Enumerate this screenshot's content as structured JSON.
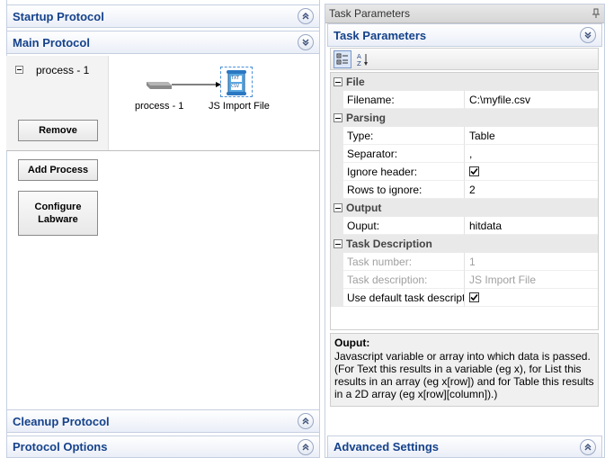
{
  "left_panel": {
    "startup_protocol": "Startup Protocol",
    "main_protocol": "Main Protocol",
    "cleanup_protocol": "Cleanup Protocol",
    "protocol_options": "Protocol Options",
    "tree_item": "process - 1",
    "remove_button": "Remove",
    "add_process_button": "Add Process",
    "configure_labware_button": "Configure Labware",
    "node_process_label": "process - 1",
    "node_js_label": "JS Import File",
    "js_icon_lines": [
      "TXT",
      "CSV"
    ]
  },
  "right_panel": {
    "window_title": "Task Parameters",
    "section_title": "Task Parameters",
    "advanced_settings": "Advanced Settings",
    "categories": {
      "file": "File",
      "parsing": "Parsing",
      "output": "Output",
      "task_description": "Task Description"
    },
    "props": {
      "filename": {
        "name": "Filename:",
        "value": "C:\\myfile.csv"
      },
      "type": {
        "name": "Type:",
        "value": "Table"
      },
      "separator": {
        "name": "Separator:",
        "value": ","
      },
      "ignore_header": {
        "name": "Ignore header:",
        "checked": true
      },
      "rows_to_ignore": {
        "name": "Rows to ignore:",
        "value": "2"
      },
      "ouput": {
        "name": "Ouput:",
        "value": "hitdata"
      },
      "task_number": {
        "name": "Task number:",
        "value": "1"
      },
      "task_description": {
        "name": "Task description:",
        "value": "JS Import File"
      },
      "use_default": {
        "name": "Use default task descript",
        "checked": true
      }
    },
    "description": {
      "title": "Ouput:",
      "text": "Javascript variable or array into which data is passed. (For Text this results in a variable (eg x), for List this results in an array (eg x[row]) and for Table this results in a 2D array (eg x[row][column]).)"
    }
  },
  "colors": {
    "header_text": "#15428b",
    "panel_border": "#c5cfe0",
    "category_bg": "#e9e9e9"
  }
}
